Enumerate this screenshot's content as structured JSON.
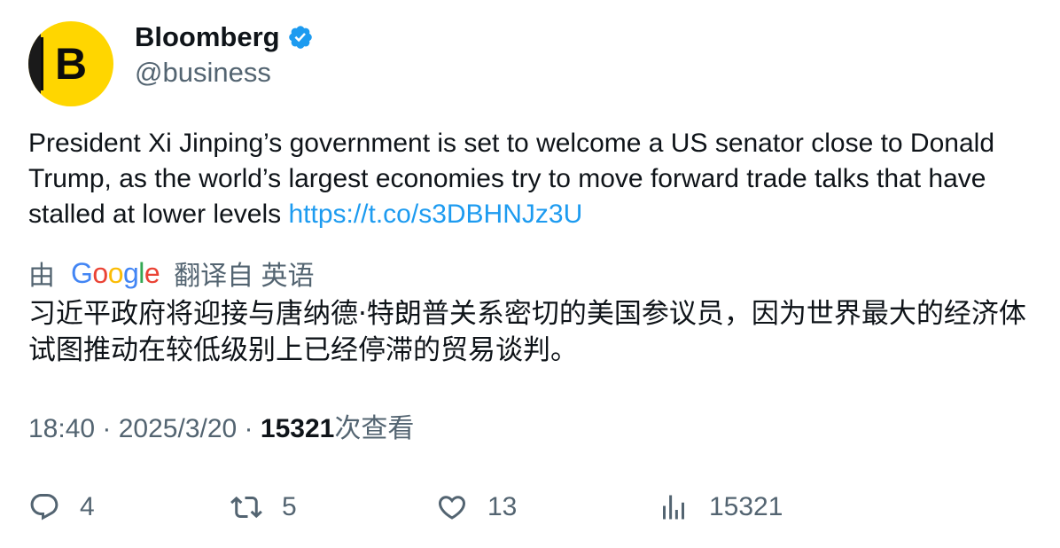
{
  "author": {
    "avatar_letter": "B",
    "display_name": "Bloomberg",
    "handle": "@business",
    "verified": true,
    "brand_color": "#ffd600",
    "verified_color": "#1d9bf0"
  },
  "tweet": {
    "text": "President Xi Jinping’s government is set to welcome a US senator close to Donald Trump, as the world’s largest economies try to move forward trade talks that have stalled at lower levels ",
    "link": "https://t.co/s3DBHNJz3U",
    "link_color": "#1d9bf0"
  },
  "translation": {
    "prefix": "由",
    "provider": "Google",
    "label": "翻译自 英语",
    "text": "习近平政府将迎接与唐纳德·特朗普关系密切的美国参议员，因为世界最大的经济体试图推动在较低级别上已经停滞的贸易谈判。"
  },
  "meta": {
    "time": "18:40",
    "separator": " · ",
    "date": "2025/3/20",
    "views_number": "15321",
    "views_suffix": "次查看"
  },
  "actions": {
    "reply": {
      "icon": "reply-icon",
      "count": "4"
    },
    "retweet": {
      "icon": "retweet-icon",
      "count": "5"
    },
    "like": {
      "icon": "heart-icon",
      "count": "13"
    },
    "views": {
      "icon": "analytics-icon",
      "count": "15321"
    }
  }
}
